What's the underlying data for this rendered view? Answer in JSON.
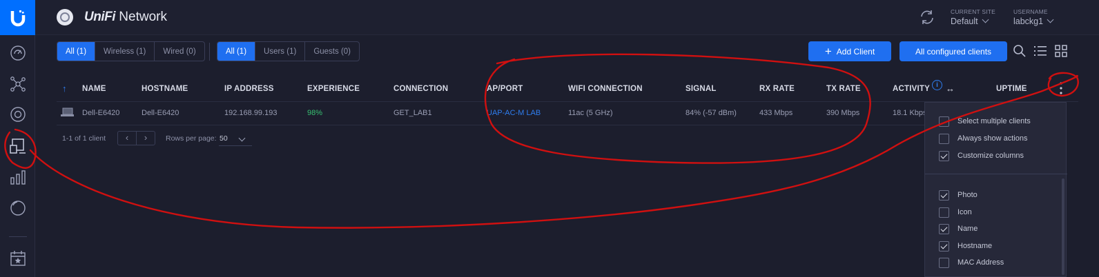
{
  "header": {
    "brand": "UniFi",
    "product": "Network",
    "current_site_label": "CURRENT SITE",
    "current_site_value": "Default",
    "username_label": "USERNAME",
    "username_value": "labckg1"
  },
  "sidebar": {
    "items": [
      {
        "icon": "dashboard-icon"
      },
      {
        "icon": "topology-icon"
      },
      {
        "icon": "devices-icon"
      },
      {
        "icon": "clients-icon",
        "active": true
      },
      {
        "icon": "statistics-icon"
      },
      {
        "icon": "insights-icon"
      },
      {
        "icon": "events-icon"
      }
    ]
  },
  "toolbar": {
    "conn_filters": [
      "All (1)",
      "Wireless (1)",
      "Wired (0)"
    ],
    "type_filters": [
      "All (1)",
      "Users (1)",
      "Guests (0)"
    ],
    "add_client_label": "Add Client",
    "all_configured_label": "All configured clients"
  },
  "table": {
    "columns": [
      "NAME",
      "HOSTNAME",
      "IP ADDRESS",
      "EXPERIENCE",
      "CONNECTION",
      "AP/PORT",
      "WIFI CONNECTION",
      "SIGNAL",
      "RX RATE",
      "TX RATE",
      "ACTIVITY",
      "UPTIME"
    ],
    "rows": [
      {
        "name": "Dell-E6420",
        "hostname": "Dell-E6420",
        "ip": "192.168.99.193",
        "experience": "98%",
        "connection": "GET_LAB1",
        "ap_port": "UAP-AC-M LAB",
        "wifi": "11ac (5 GHz)",
        "signal": "84% (-57 dBm)",
        "rx": "433 Mbps",
        "tx": "390 Mbps",
        "activity": "18.1 Kbps"
      }
    ],
    "summary": "1-1 of 1 client",
    "rows_per_page_label": "Rows per page:",
    "rows_per_page_value": "50"
  },
  "menu": {
    "actions": [
      {
        "label": "Select multiple clients",
        "checked": false
      },
      {
        "label": "Always show actions",
        "checked": false
      },
      {
        "label": "Customize columns",
        "checked": true
      }
    ],
    "columns": [
      {
        "label": "Photo",
        "checked": true
      },
      {
        "label": "Icon",
        "checked": false
      },
      {
        "label": "Name",
        "checked": true
      },
      {
        "label": "Hostname",
        "checked": true
      },
      {
        "label": "MAC Address",
        "checked": false
      }
    ]
  },
  "colors": {
    "accent": "#1f6ff0",
    "experience_good": "#38c172",
    "link": "#2f7ef0",
    "annotation": "#d01010"
  }
}
